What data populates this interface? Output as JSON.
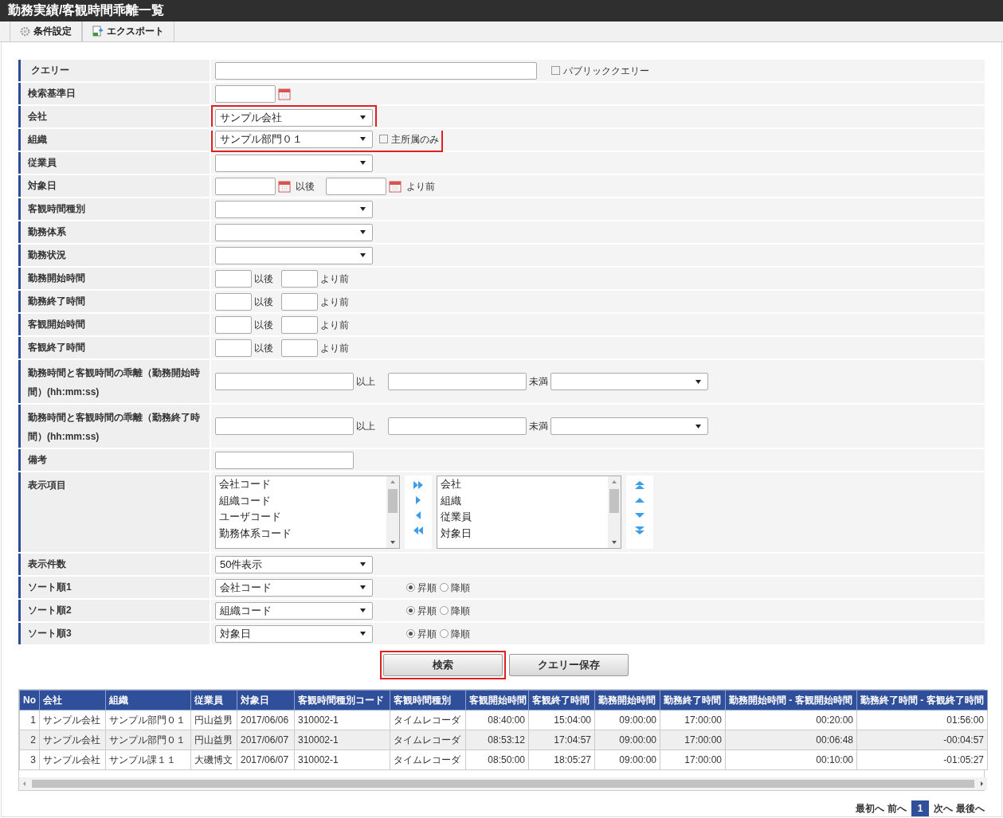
{
  "window": {
    "title": "勤務実績/客観時間乖離一覧"
  },
  "toolbar": [
    {
      "label": "条件設定",
      "kind": "settings"
    },
    {
      "label": "エクスポート",
      "kind": "export"
    }
  ],
  "form": {
    "rows": [
      {
        "kind": "query",
        "label": "クエリー",
        "checkbox": {
          "label": "パブリッククエリー",
          "checked": false
        }
      },
      {
        "kind": "date",
        "label": "検索基準日"
      },
      {
        "kind": "select",
        "label": "会社",
        "value": "サンプル会社",
        "highlighted": true
      },
      {
        "kind": "select",
        "label": "組織",
        "value": "サンプル部門０１",
        "highlighted": true,
        "checkbox": {
          "label": "主所属のみ",
          "checked": false
        }
      },
      {
        "kind": "select",
        "label": "従業員"
      },
      {
        "kind": "daterange",
        "label": "対象日",
        "after": "以後",
        "before": "より前"
      },
      {
        "kind": "select",
        "label": "客観時間種別"
      },
      {
        "kind": "select",
        "label": "勤務体系"
      },
      {
        "kind": "select",
        "label": "勤務状況"
      },
      {
        "kind": "timerange",
        "label": "勤務開始時間",
        "after": "以後",
        "before": "より前"
      },
      {
        "kind": "timerange",
        "label": "勤務終了時間",
        "after": "以後",
        "before": "より前"
      },
      {
        "kind": "timerange",
        "label": "客観開始時間",
        "after": "以後",
        "before": "より前"
      },
      {
        "kind": "timerange",
        "label": "客観終了時間",
        "after": "以後",
        "before": "より前"
      },
      {
        "kind": "diffrange",
        "label": "勤務時間と客観時間の乖離（勤務開始時間）(hh:mm:ss)",
        "min_label": "以上",
        "max_label": "未満"
      },
      {
        "kind": "diffrange",
        "label": "勤務時間と客観時間の乖離（勤務終了時間）(hh:mm:ss)",
        "min_label": "以上",
        "max_label": "未満"
      },
      {
        "kind": "text",
        "label": "備考"
      },
      {
        "kind": "listbox",
        "label": "表示項目",
        "available": [
          "会社コード",
          "組織コード",
          "ユーザコード",
          "勤務体系コード"
        ],
        "chosen": [
          "会社",
          "組織",
          "従業員",
          "対象日"
        ]
      },
      {
        "kind": "select",
        "label": "表示件数",
        "value": "50件表示"
      },
      {
        "kind": "sort",
        "label": "ソート順1",
        "value": "会社コード",
        "options": [
          {
            "label": "昇順",
            "selected": true
          },
          {
            "label": "降順",
            "selected": false
          }
        ]
      },
      {
        "kind": "sort",
        "label": "ソート順2",
        "value": "組織コード",
        "options": [
          {
            "label": "昇順",
            "selected": true
          },
          {
            "label": "降順",
            "selected": false
          }
        ]
      },
      {
        "kind": "sort",
        "label": "ソート順3",
        "value": "対象日",
        "options": [
          {
            "label": "昇順",
            "selected": true
          },
          {
            "label": "降順",
            "selected": false
          }
        ]
      }
    ]
  },
  "buttons": [
    {
      "label": "検索",
      "highlighted": true
    },
    {
      "label": "クエリー保存",
      "highlighted": false
    }
  ],
  "table": {
    "columns": [
      "No",
      "会社",
      "組織",
      "従業員",
      "対象日",
      "客観時間種別コード",
      "客観時間種別",
      "客観開始時間",
      "客観終了時間",
      "勤務開始時間",
      "勤務終了時間",
      "勤務開始時間 - 客観開始時間",
      "勤務終了時間 - 客観終了時間"
    ],
    "rows": [
      [
        "1",
        "サンプル会社",
        "サンプル部門０１",
        "円山益男",
        "2017/06/06",
        "310002-1",
        "タイムレコーダ",
        "08:40:00",
        "15:04:00",
        "09:00:00",
        "17:00:00",
        "00:20:00",
        "01:56:00"
      ],
      [
        "2",
        "サンプル会社",
        "サンプル部門０１",
        "円山益男",
        "2017/06/07",
        "310002-1",
        "タイムレコーダ",
        "08:53:12",
        "17:04:57",
        "09:00:00",
        "17:00:00",
        "00:06:48",
        "-00:04:57"
      ],
      [
        "3",
        "サンプル会社",
        "サンプル課１１",
        "大磯博文",
        "2017/06/07",
        "310002-1",
        "タイムレコーダ",
        "08:50:00",
        "18:05:27",
        "09:00:00",
        "17:00:00",
        "00:10:00",
        "-01:05:27"
      ]
    ]
  },
  "pagination": {
    "first": "最初へ",
    "prev": "前へ",
    "pages": [
      {
        "label": "1",
        "selected": true
      }
    ],
    "next": "次へ",
    "last": "最後へ"
  }
}
